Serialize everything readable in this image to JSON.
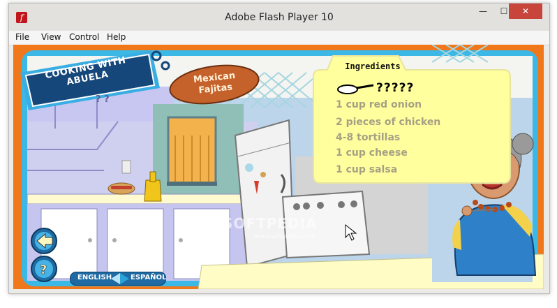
{
  "window": {
    "title": "Adobe Flash Player 10",
    "app_icon_glyph": "f",
    "controls": {
      "minimize": "—",
      "maximize": "☐",
      "close": "✕"
    }
  },
  "menu": [
    "File",
    "View",
    "Control",
    "Help"
  ],
  "game": {
    "logo": "COOKING WITH ABUELA",
    "dish_line1": "Mexican",
    "dish_line2": "Fajitas",
    "ingredients_title": "Ingredients",
    "question_marks": "?????",
    "ingredients": [
      "1 cup red onion",
      "2 pieces of chicken",
      "4-8 tortillas",
      "1 cup cheese",
      "1 cup salsa"
    ],
    "cabinet_question": "? ?",
    "lang_english": "ENGLISH",
    "lang_spanish": "ESPAÑOL",
    "watermark": "SOFTPEDIA",
    "watermark_sub": "www.softpedia.com"
  },
  "colors": {
    "frame": "#3bb8e6",
    "orange_bg": "#f0771a",
    "card": "#ffff9e",
    "logo_bg": "#15477a"
  }
}
